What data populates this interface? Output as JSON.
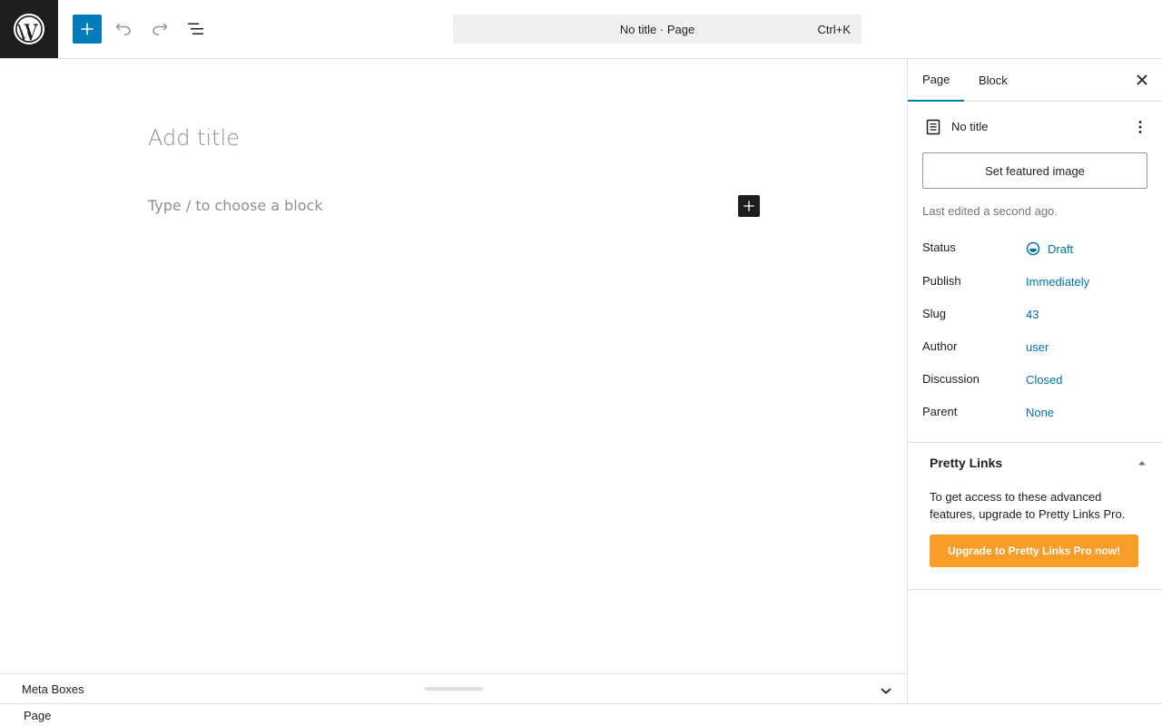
{
  "topbar": {
    "logo_icon": "wordpress-logo-icon",
    "add_icon": "plus-icon",
    "undo_icon": "undo-icon",
    "redo_icon": "redo-icon",
    "list_view_icon": "list-view-icon",
    "command_title": "No title · Page",
    "command_shortcut": "Ctrl+K",
    "accent_color": "#007cba"
  },
  "editor": {
    "title_placeholder": "Add title",
    "block_placeholder": "Type / to choose a block",
    "inline_add_icon": "plus-icon"
  },
  "metabox": {
    "label": "Meta Boxes",
    "toggle_icon": "chevron-down-icon"
  },
  "footer": {
    "breadcrumb": "Page"
  },
  "sidebar": {
    "tabs": [
      {
        "label": "Page",
        "active": true
      },
      {
        "label": "Block",
        "active": false
      }
    ],
    "close_icon": "close-icon",
    "document": {
      "icon": "page-icon",
      "title": "No title",
      "more_icon": "more-vertical-icon"
    },
    "featured_image_label": "Set featured image",
    "last_edited": "Last edited a second ago.",
    "meta": [
      {
        "label": "Status",
        "value": "Draft"
      },
      {
        "label": "Publish",
        "value": "Immediately"
      },
      {
        "label": "Slug",
        "value": "43"
      },
      {
        "label": "Author",
        "value": "user"
      },
      {
        "label": "Discussion",
        "value": "Closed"
      },
      {
        "label": "Parent",
        "value": "None"
      }
    ],
    "pretty_links": {
      "title": "Pretty Links",
      "toggle_icon": "chevron-up-icon",
      "text": "To get access to these advanced features, upgrade to Pretty Links Pro.",
      "button_label": "Upgrade to Pretty Links Pro now!",
      "button_color": "#f99d28"
    }
  }
}
